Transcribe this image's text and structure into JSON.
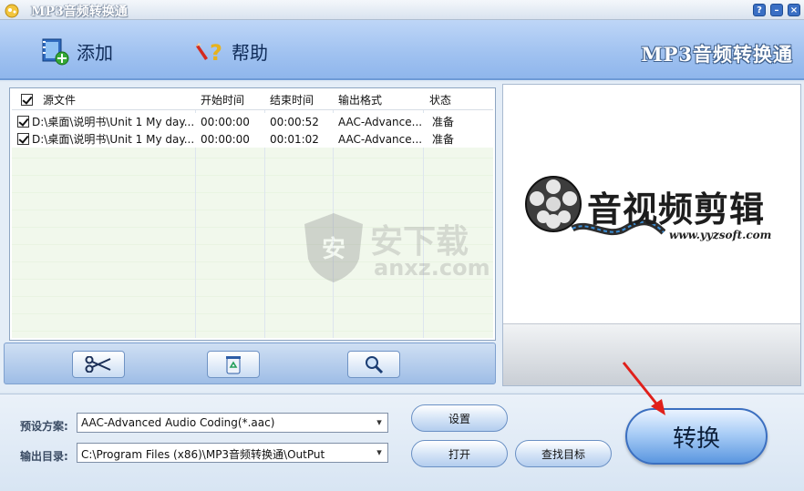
{
  "window": {
    "title": "MP3音频转换通",
    "help_btn": "?",
    "min_btn": "–",
    "close_btn": "×"
  },
  "toolbar": {
    "add_label": "添加",
    "help_label": "帮助",
    "brand": "MP3音频转换通"
  },
  "table": {
    "columns": [
      "源文件",
      "开始时间",
      "结束时间",
      "输出格式",
      "状态"
    ],
    "rows": [
      {
        "checked": true,
        "source": "D:\\桌面\\说明书\\Unit 1 My day...",
        "start": "00:00:00",
        "end": "00:00:52",
        "format": "AAC-Advance...",
        "status": "准备"
      },
      {
        "checked": true,
        "source": "D:\\桌面\\说明书\\Unit 1 My day...",
        "start": "00:00:00",
        "end": "00:01:02",
        "format": "AAC-Advance...",
        "status": "准备"
      }
    ]
  },
  "preview": {
    "logo_text": "音视频剪辑",
    "logo_url": "www.yyzsoft.com"
  },
  "watermark": {
    "cn": "安下载",
    "en": "anxz.com",
    "badge": "安"
  },
  "edit": {
    "cut_icon": "scissors-icon",
    "delete_icon": "recycle-icon",
    "search_icon": "magnifier-icon"
  },
  "settings": {
    "preset_label": "预设方案:",
    "preset_value": "AAC-Advanced Audio Coding(*.aac)",
    "output_label": "输出目录:",
    "output_value": "C:\\Program Files (x86)\\MP3音频转换通\\OutPut",
    "settings_btn": "设置",
    "open_btn": "打开",
    "find_btn": "查找目标",
    "convert_btn": "转换"
  },
  "colors": {
    "accent": "#3b6fc0",
    "toolbar": "#9fc1f0",
    "annotation_arrow": "#e0201b"
  }
}
